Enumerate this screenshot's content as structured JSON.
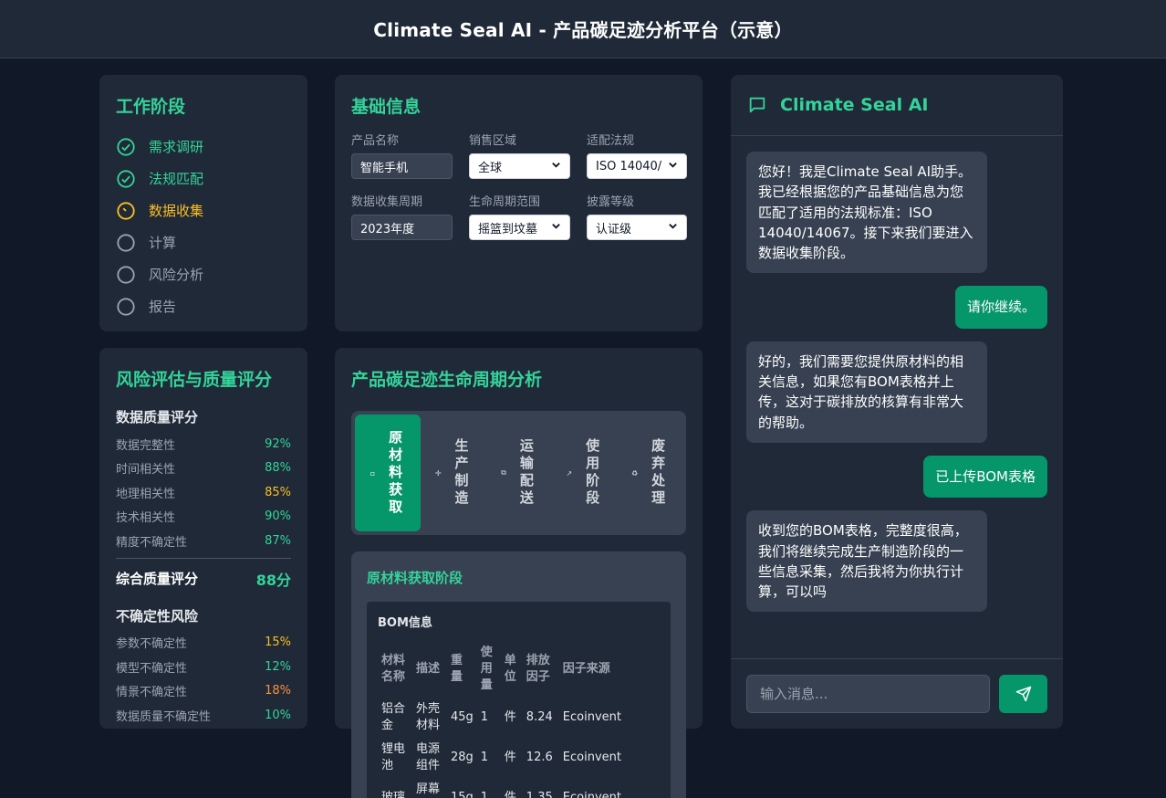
{
  "header": {
    "title": "Climate Seal AI - 产品碳足迹分析平台（示意）"
  },
  "stages": {
    "title": "工作阶段",
    "items": [
      {
        "label": "需求调研",
        "status": "done"
      },
      {
        "label": "法规匹配",
        "status": "done"
      },
      {
        "label": "数据收集",
        "status": "active"
      },
      {
        "label": "计算",
        "status": "todo"
      },
      {
        "label": "风险分析",
        "status": "todo"
      },
      {
        "label": "报告",
        "status": "todo"
      }
    ]
  },
  "risk": {
    "title": "风险评估与质量评分",
    "quality_head": "数据质量评分",
    "quality": [
      {
        "label": "数据完整性",
        "value": "92%",
        "color": "green"
      },
      {
        "label": "时间相关性",
        "value": "88%",
        "color": "green"
      },
      {
        "label": "地理相关性",
        "value": "85%",
        "color": "yellow"
      },
      {
        "label": "技术相关性",
        "value": "90%",
        "color": "green"
      },
      {
        "label": "精度不确定性",
        "value": "87%",
        "color": "green"
      }
    ],
    "overall_label": "综合质量评分",
    "overall_value": "88分",
    "uncertainty_head": "不确定性风险",
    "uncertainty": [
      {
        "label": "参数不确定性",
        "value": "15%",
        "color": "yellow"
      },
      {
        "label": "模型不确定性",
        "value": "12%",
        "color": "green"
      },
      {
        "label": "情景不确定性",
        "value": "18%",
        "color": "orange"
      },
      {
        "label": "数据质量不确定性",
        "value": "10%",
        "color": "green"
      }
    ]
  },
  "basic": {
    "title": "基础信息",
    "fields": [
      {
        "label": "产品名称",
        "value": "智能手机",
        "kind": "input"
      },
      {
        "label": "销售区域",
        "value": "全球",
        "kind": "select"
      },
      {
        "label": "适配法规",
        "value": "ISO 14040/",
        "kind": "select"
      },
      {
        "label": "数据收集周期",
        "value": "2023年度",
        "kind": "input"
      },
      {
        "label": "生命周期范围",
        "value": "摇篮到坟墓",
        "kind": "select"
      },
      {
        "label": "披露等级",
        "value": "认证级",
        "kind": "select"
      }
    ]
  },
  "lifecycle": {
    "title": "产品碳足迹生命周期分析",
    "tabs": [
      {
        "label": "原材料获取",
        "active": true
      },
      {
        "label": "生产制造",
        "active": false
      },
      {
        "label": "运输配送",
        "active": false
      },
      {
        "label": "使用阶段",
        "active": false
      },
      {
        "label": "废弃处理",
        "active": false
      }
    ],
    "phase_title": "原材料获取阶段",
    "bom_title": "BOM信息",
    "bom_headers": [
      "材料名称",
      "描述",
      "重量",
      "使用量",
      "单位",
      "排放因子",
      "因子来源"
    ],
    "bom_rows": [
      [
        "铝合金",
        "外壳材料",
        "45g",
        "1",
        "件",
        "8.24",
        "Ecoinvent"
      ],
      [
        "锂电池",
        "电源组件",
        "28g",
        "1",
        "件",
        "12.6",
        "Ecoinvent"
      ],
      [
        "玻璃",
        "屏幕材料",
        "15g",
        "1",
        "件",
        "1.35",
        "Ecoinvent"
      ]
    ]
  },
  "chat": {
    "title": "Climate Seal AI",
    "messages": [
      {
        "role": "ai",
        "text": "您好！我是Climate Seal AI助手。我已经根据您的产品基础信息为您匹配了适用的法规标准：ISO 14040/14067。接下来我们要进入数据收集阶段。"
      },
      {
        "role": "user",
        "text": "请你继续。"
      },
      {
        "role": "ai",
        "text": "好的，我们需要您提供原材料的相关信息，如果您有BOM表格并上传，这对于碳排放的核算有非常大的帮助。"
      },
      {
        "role": "user",
        "text": "已上传BOM表格"
      },
      {
        "role": "ai",
        "text": "收到您的BOM表格，完整度很高，我们将继续完成生产制造阶段的一些信息采集，然后我将为你执行计算，可以吗"
      }
    ],
    "input_placeholder": "输入消息..."
  },
  "colors": {
    "accent": "#34d399",
    "primary_button": "#059669",
    "warning": "#fbbf24",
    "danger": "#fb923c",
    "bg": "#111827",
    "card": "#1f2937"
  }
}
